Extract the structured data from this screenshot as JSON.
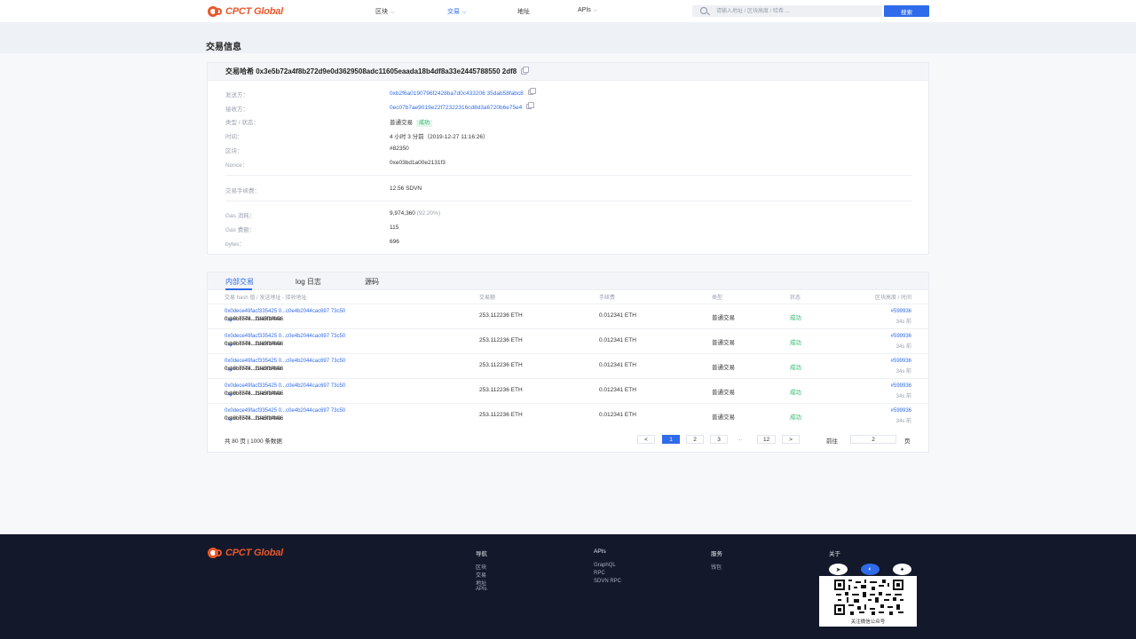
{
  "header": {
    "logo": "CPCT Global",
    "nav": [
      {
        "label": "区块",
        "has_caret": true,
        "active": false
      },
      {
        "label": "交易",
        "has_caret": true,
        "active": true
      },
      {
        "label": "地址",
        "has_caret": false,
        "active": false
      },
      {
        "label": "APIs",
        "has_caret": true,
        "active": false
      }
    ],
    "search_placeholder": "请输入地址 / 区块高度 / 哈希 ...",
    "search_button": "搜索"
  },
  "page_title": "交易信息",
  "tx": {
    "hash_label": "交易哈希",
    "hash": "0x3e5b72a4f8b272d9e0d3629508adc11605eaada18b4df8a33e2445788550 2df8",
    "from_label": "发送方：",
    "from": "0xb2f6a0190796f2428ba7d0c433206 35dab58fabc8",
    "to_label": "接收方：",
    "to": "0ec07b7ae9019e22f72322316cd8d3a6720b6e75e4",
    "type_label": "类型 / 状态：",
    "type": "普通交易",
    "status": "成功",
    "time_label": "时间：",
    "time": "4 小时 3 分前（2019-12-27 11:16:26）",
    "block_label": "区块：",
    "block": "#82350",
    "nonce_label": "Nonce：",
    "nonce": "0xe03bd1a00e2131f3",
    "fee_label": "交易手续费：",
    "fee": "12.56 SDVN",
    "gas_used_label": "Gas 消耗：",
    "gas_used": "9,974,360",
    "gas_used_pct": "(92.20%)",
    "gas_price_label": "Gas 费额：",
    "gas_price": "115",
    "bytes_label": "bytes：",
    "bytes": "696"
  },
  "tabs": [
    "内部交易",
    "log 日志",
    "源码"
  ],
  "table": {
    "columns": [
      "交易 hash 值 / 发送地址 - 接收地址",
      "交易额",
      "手续费",
      "类型",
      "状态",
      "区块高度 / 时间"
    ],
    "rows": [
      {
        "hash": "0x0dece49facf335425 0...c0e4b2044cac697 73c50",
        "from": "0xb8c7748...2e45f1f44e",
        "to": "0xe9b6574...f1fa9fb4b06",
        "amount": "253.112236 ETH",
        "fee": "0.012341 ETH",
        "type": "普通交易",
        "status": "成功",
        "block": "#599936",
        "ago": "34s 前"
      },
      {
        "hash": "0x0dece49facf335425 0...c0e4b2044cac697 73c50",
        "from": "0xb8c7748...2e45f1f44e",
        "to": "0xe9b6574...f1fa9fb4b06",
        "amount": "253.112236 ETH",
        "fee": "0.012341 ETH",
        "type": "普通交易",
        "status": "成功",
        "block": "#599936",
        "ago": "34s 前"
      },
      {
        "hash": "0x0dece49facf335425 0...c0e4b2044cac697 73c50",
        "from": "0xb8c7748...2e45f1f44e",
        "to": "0xe9b6574...f1fa9fb4b06",
        "amount": "253.112236 ETH",
        "fee": "0.012341 ETH",
        "type": "普通交易",
        "status": "成功",
        "block": "#599936",
        "ago": "34s 前"
      },
      {
        "hash": "0x0dece49facf335425 0...c0e4b2044cac697 73c50",
        "from": "0xb8c7748...2e45f1f44e",
        "to": "0xe9b6574...f1fa9fb4b06",
        "amount": "253.112236 ETH",
        "fee": "0.012341 ETH",
        "type": "普通交易",
        "status": "成功",
        "block": "#599936",
        "ago": "34s 前"
      },
      {
        "hash": "0x0dece49facf335425 0...c0e4b2044cac697 73c50",
        "from": "0xb8c7748...2e45f1f44e",
        "to": "0xe9b6574...f1fa9fb4b06",
        "amount": "253.112236 ETH",
        "fee": "0.012341 ETH",
        "type": "普通交易",
        "status": "成功",
        "block": "#599936",
        "ago": "34s 前"
      }
    ]
  },
  "pagination": {
    "total": "共 80 页 | 1000 条数据",
    "prev": "<",
    "pages": [
      "1",
      "2",
      "3"
    ],
    "current": "1",
    "ellipsis": "...",
    "last": "12",
    "next": ">",
    "goto_label": "前往",
    "goto_value": "2",
    "goto_suffix": "页"
  },
  "footer": {
    "logo": "CPCT Global",
    "cols": [
      {
        "title": "导航",
        "links": [
          "区块",
          "交易",
          "地址",
          "APIs"
        ]
      },
      {
        "title": "APIs",
        "links": [
          "GraphQL",
          "RPC",
          "SDVN RPC"
        ]
      },
      {
        "title": "服务",
        "links": [
          "钱包"
        ]
      },
      {
        "title": "关于",
        "links": []
      }
    ],
    "social_icons": [
      "telegram-icon",
      "weibo-icon",
      "twitter-icon"
    ],
    "qr_caption": "关注微信公众号"
  }
}
